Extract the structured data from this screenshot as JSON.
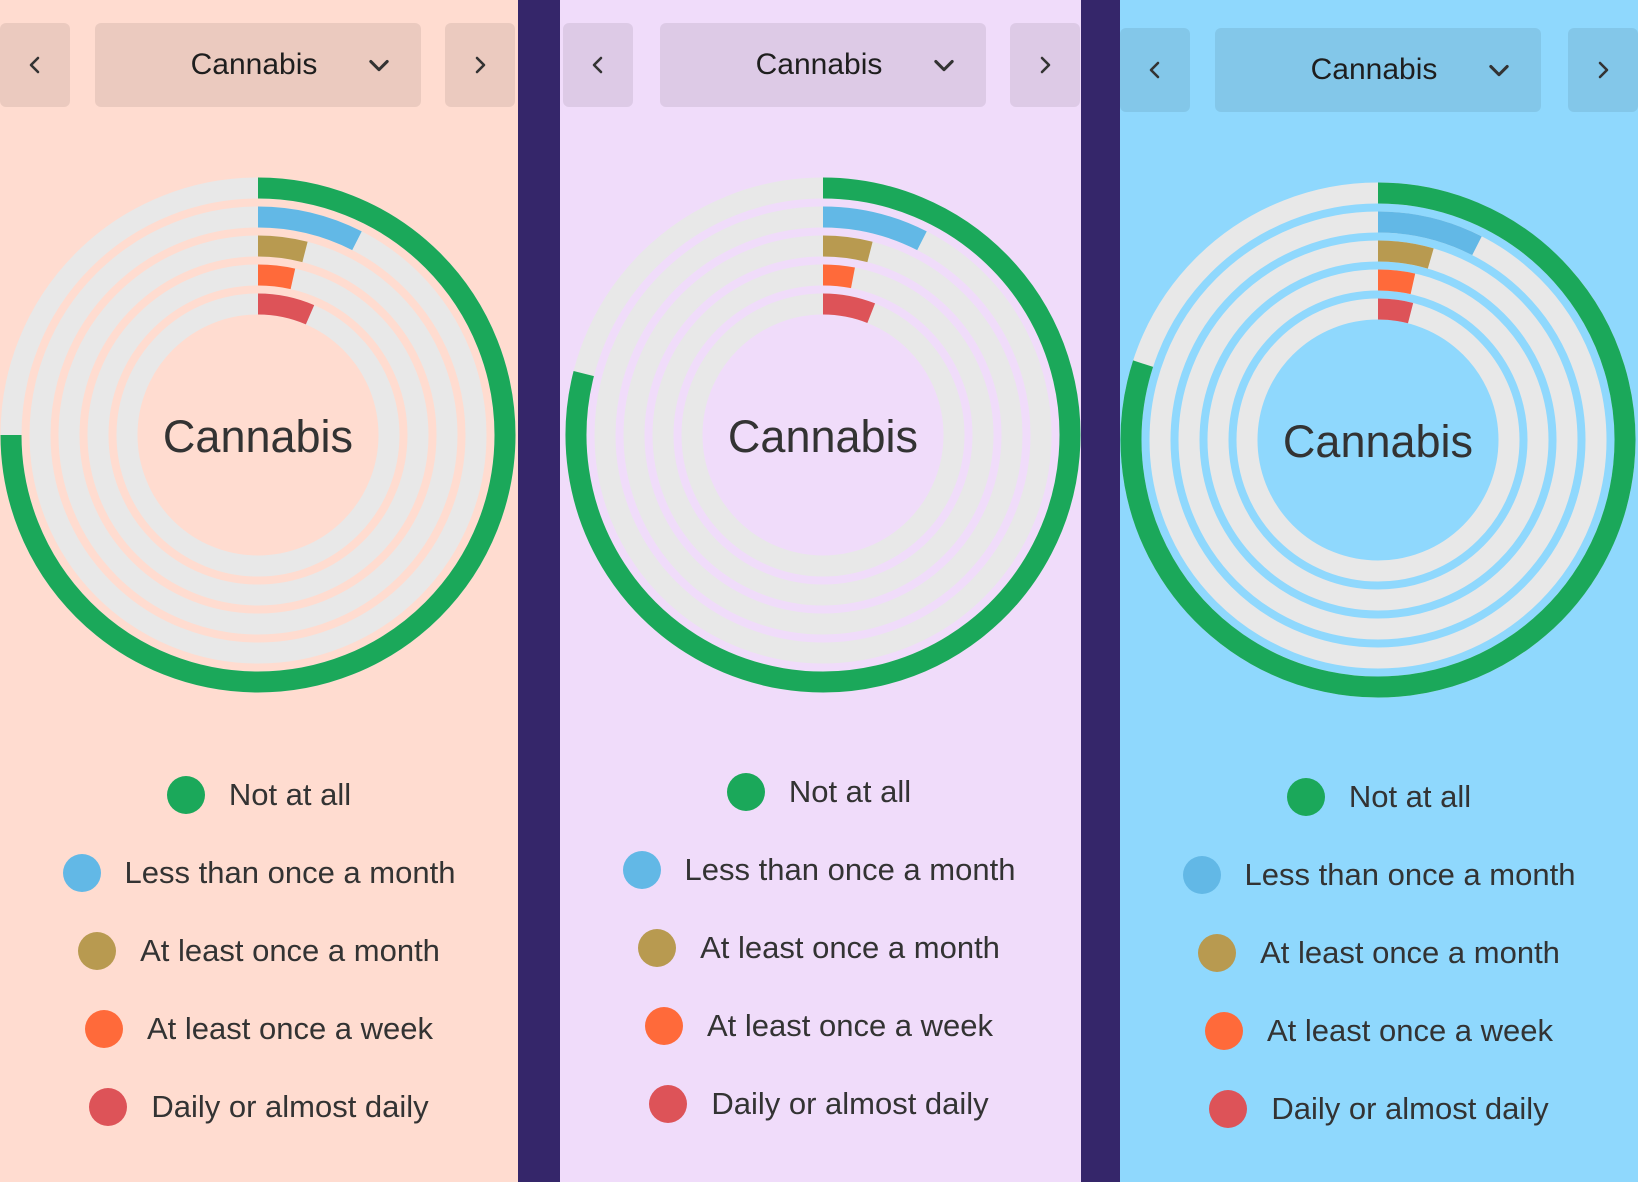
{
  "panels": [
    {
      "background": "#ffdcd0",
      "dropdown": {
        "selected": "Cannabis"
      },
      "center_label": "Cannabis"
    },
    {
      "background": "#f0dcfa",
      "dropdown": {
        "selected": "Cannabis"
      },
      "center_label": "Cannabis"
    },
    {
      "background": "#8fd8fd",
      "dropdown": {
        "selected": "Cannabis"
      },
      "center_label": "Cannabis"
    }
  ],
  "icons": {
    "prev": "chevron-left-icon",
    "next": "chevron-right-icon",
    "dropdown": "chevron-down-icon"
  },
  "chart_data": [
    {
      "type": "radial-bar",
      "title": "Cannabis",
      "max_value": 100,
      "series": [
        {
          "name": "Not at all",
          "value": 75,
          "color": "#1ba85a"
        },
        {
          "name": "Less than once a month",
          "value": 7.5,
          "color": "#62b8e6"
        },
        {
          "name": "At least once a month",
          "value": 4,
          "color": "#b89a50"
        },
        {
          "name": "At least once a week",
          "value": 3.5,
          "color": "#ff6a3a"
        },
        {
          "name": "Daily or almost daily",
          "value": 6.5,
          "color": "#dd5358"
        }
      ]
    },
    {
      "type": "radial-bar",
      "title": "Cannabis",
      "max_value": 100,
      "series": [
        {
          "name": "Not at all",
          "value": 79,
          "color": "#1ba85a"
        },
        {
          "name": "Less than once a month",
          "value": 7.5,
          "color": "#62b8e6"
        },
        {
          "name": "At least once a month",
          "value": 4,
          "color": "#b89a50"
        },
        {
          "name": "At least once a week",
          "value": 3,
          "color": "#ff6a3a"
        },
        {
          "name": "Daily or almost daily",
          "value": 6,
          "color": "#dd5358"
        }
      ]
    },
    {
      "type": "radial-bar",
      "title": "Cannabis",
      "max_value": 100,
      "series": [
        {
          "name": "Not at all",
          "value": 80,
          "color": "#1ba85a"
        },
        {
          "name": "Less than once a month",
          "value": 7.5,
          "color": "#62b8e6"
        },
        {
          "name": "At least once a month",
          "value": 4.5,
          "color": "#b89a50"
        },
        {
          "name": "At least once a week",
          "value": 3.5,
          "color": "#ff6a3a"
        },
        {
          "name": "Daily or almost daily",
          "value": 4,
          "color": "#dd5358"
        }
      ]
    }
  ],
  "track_color": "#e8e8e8",
  "text_color": "#333333"
}
